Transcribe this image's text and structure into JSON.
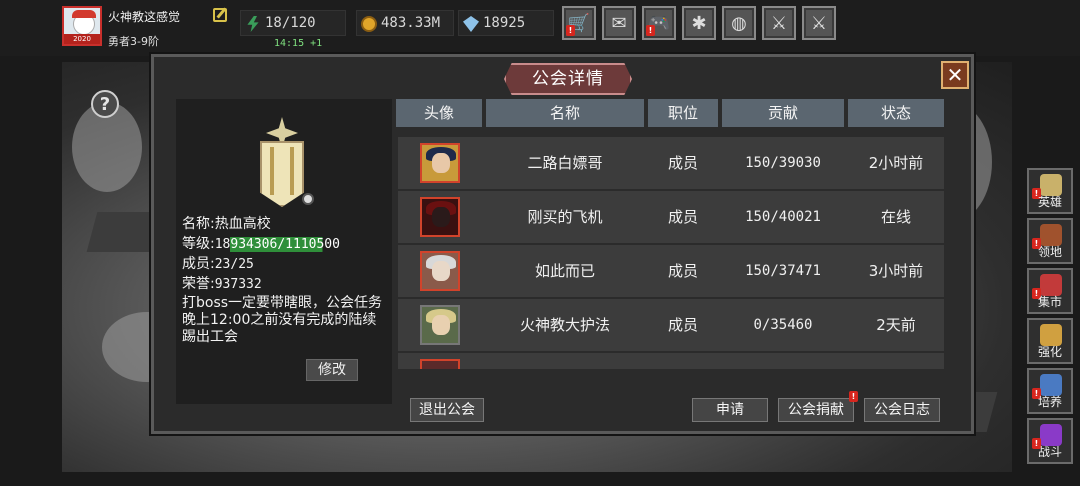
{
  "header": {
    "player_name": "火神教这感觉",
    "player_rank": "勇者3-9阶",
    "avatar_year": "2020",
    "energy": "18/120",
    "energy_regen": "14:15 +1",
    "gold": "483.33M",
    "gems": "18925"
  },
  "top_buttons": [
    {
      "name": "shop-icon",
      "glyph": "🛒",
      "badge": true
    },
    {
      "name": "mail-icon",
      "glyph": "✉",
      "badge": false
    },
    {
      "name": "gamepad-icon",
      "glyph": "🎮",
      "badge": true
    },
    {
      "name": "settings-icon",
      "glyph": "✱",
      "badge": false
    },
    {
      "name": "color-wheel-icon",
      "glyph": "◍",
      "badge": false
    },
    {
      "name": "sword-icon",
      "glyph": "⚔",
      "badge": false
    },
    {
      "name": "crossed-swords-icon",
      "glyph": "⚔",
      "badge": false
    }
  ],
  "side_menu": [
    {
      "label": "英雄",
      "color": "#c9b16a",
      "badge": true
    },
    {
      "label": "领地",
      "color": "#a0522d",
      "badge": true
    },
    {
      "label": "集市",
      "color": "#c23a3a",
      "badge": true
    },
    {
      "label": "强化",
      "color": "#d0a040",
      "badge": false
    },
    {
      "label": "培养",
      "color": "#4a7ac2",
      "badge": true
    },
    {
      "label": "战斗",
      "color": "#8a3ac8",
      "badge": true
    }
  ],
  "dialog": {
    "title": "公会详情",
    "close_glyph": "✕"
  },
  "guild": {
    "name_label": "名称:",
    "name": "热血高校",
    "level_label": "等级:",
    "level": "18",
    "exp": "934306/1110500",
    "exp_progress": 0.841,
    "members_label": "成员:",
    "members": "23/25",
    "honor_label": "荣誉:",
    "honor": "937332",
    "notice": "打boss一定要带瞎眼，公会任务晚上12:00之前没有完成的陆续踢出工会",
    "edit_label": "修改"
  },
  "table": {
    "headers": [
      "头像",
      "名称",
      "职位",
      "贡献",
      "状态"
    ],
    "rows": [
      {
        "name": "二路白嫖哥",
        "role": "成员",
        "contribution": "150/39030",
        "status": "2小时前",
        "online": false
      },
      {
        "name": "刚买的飞机",
        "role": "成员",
        "contribution": "150/40021",
        "status": "在线",
        "online": true
      },
      {
        "name": "如此而已",
        "role": "成员",
        "contribution": "150/37471",
        "status": "3小时前",
        "online": false
      },
      {
        "name": "火神教大护法",
        "role": "成员",
        "contribution": "0/35460",
        "status": "2天前",
        "online": false
      }
    ]
  },
  "actions": {
    "leave": "退出公会",
    "apply": "申请",
    "donate": "公会捐献",
    "log": "公会日志"
  },
  "colors": {
    "online": "#3fcf4b",
    "offline": "#8f8f8f",
    "exp_bar": "#2f8f3a",
    "badge": "#d7261e"
  }
}
